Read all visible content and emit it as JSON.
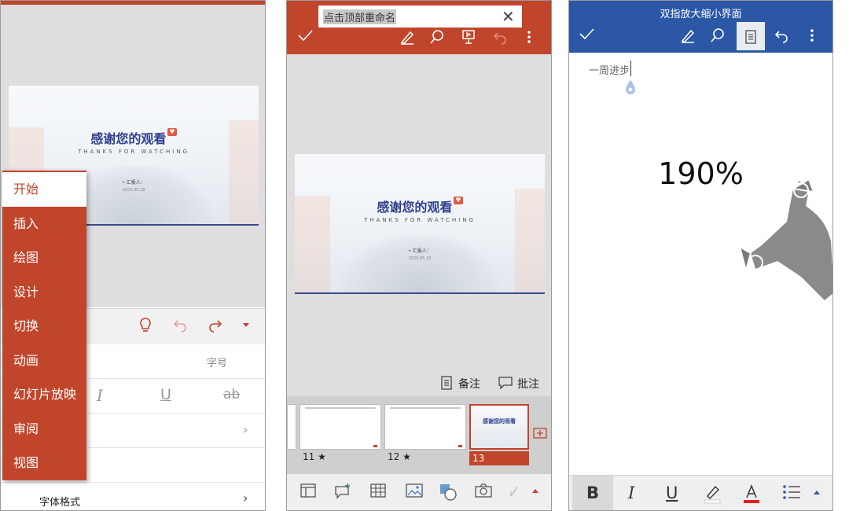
{
  "slide": {
    "title": "感谢您的观看",
    "subtitle": "THANKS FOR WATCHING",
    "reporter": "• 汇报人：",
    "date": "2020.05.18"
  },
  "phone1": {
    "menu": [
      {
        "label": "开始",
        "active": true
      },
      {
        "label": "插入"
      },
      {
        "label": "绘图"
      },
      {
        "label": "设计"
      },
      {
        "label": "切换"
      },
      {
        "label": "动画"
      },
      {
        "label": "幻灯片放映"
      },
      {
        "label": "审阅"
      },
      {
        "label": "视图"
      }
    ],
    "font_size_label": "字号",
    "font_format_label": "字体格式",
    "italic_label": "I",
    "underline_label": "U",
    "strike_label": "ab"
  },
  "phone2": {
    "rename_hint": "点击顶部重命名",
    "notes_label": "备注",
    "comments_label": "批注",
    "thumbnails": [
      {
        "number": "11 ★"
      },
      {
        "number": "12 ★"
      },
      {
        "number": "13",
        "selected": true
      }
    ]
  },
  "phone3": {
    "window_title": "双指放大缩小界面",
    "doc_text": "一周进步",
    "zoom_level": "190%",
    "bold_label": "B",
    "italic_label": "I",
    "underline_label": "U"
  },
  "colors": {
    "ppt_accent": "#c0452b",
    "word_accent": "#2b57a6",
    "slide_title": "#2f3f8f"
  }
}
